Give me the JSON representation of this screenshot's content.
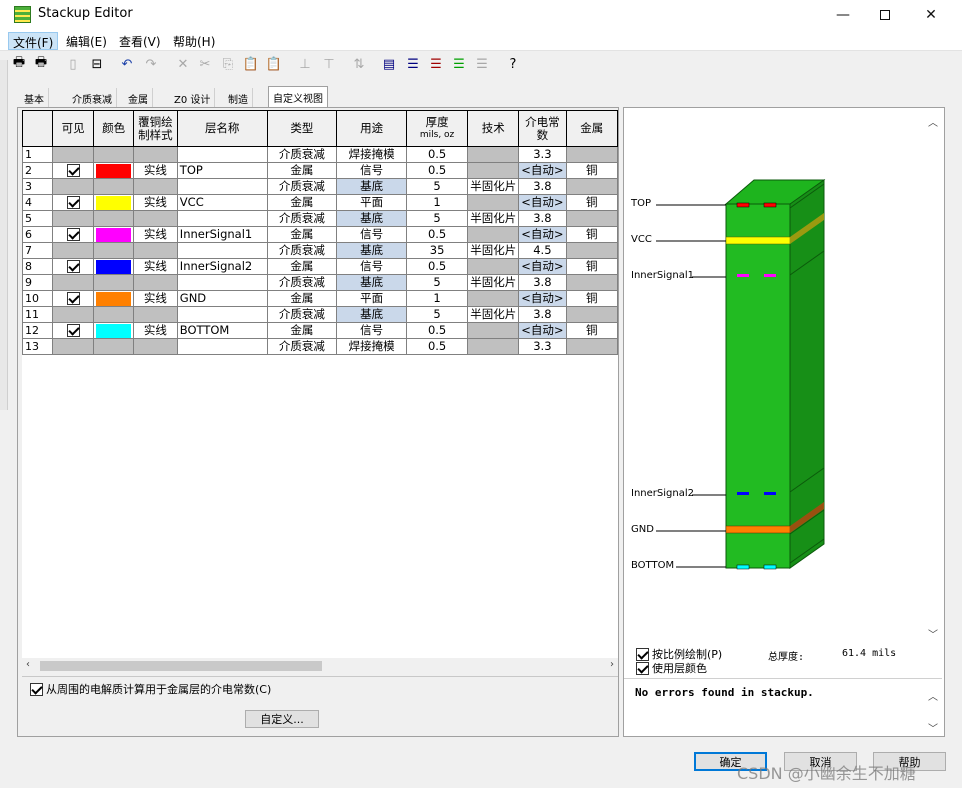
{
  "window": {
    "title": "Stackup Editor"
  },
  "menu": {
    "file": "文件(F)",
    "edit": "编辑(E)",
    "view": "查看(V)",
    "help": "帮助(H)"
  },
  "tabs": [
    "基本",
    "介质衰减",
    "金属",
    "Z0 设计",
    "制造",
    "自定义视图"
  ],
  "columns": {
    "index": "",
    "visible": "可见",
    "color": "颜色",
    "style": "覆铜绘制样式",
    "name": "层名称",
    "type": "类型",
    "usage": "用途",
    "thickness": "厚度",
    "thickness_unit": "mils, oz",
    "tech": "技术",
    "dk": "介电常数",
    "metal": "金属"
  },
  "rows": [
    {
      "n": "1",
      "visible": false,
      "color": "",
      "style": "",
      "name": "",
      "type": "介质衰减",
      "usage": "焊接掩模",
      "thickness": "0.5",
      "tech": "",
      "dk": "3.3",
      "metal": ""
    },
    {
      "n": "2",
      "visible": true,
      "color": "#ff0000",
      "style": "实线",
      "name": "TOP",
      "type": "金属",
      "usage": "信号",
      "thickness": "0.5",
      "tech": "",
      "dk": "<自动>",
      "metal": "铜"
    },
    {
      "n": "3",
      "visible": false,
      "color": "",
      "style": "",
      "name": "",
      "type": "介质衰减",
      "usage": "基底",
      "thickness": "5",
      "tech": "半固化片",
      "dk": "3.8",
      "metal": ""
    },
    {
      "n": "4",
      "visible": true,
      "color": "#ffff00",
      "style": "实线",
      "name": "VCC",
      "type": "金属",
      "usage": "平面",
      "thickness": "1",
      "tech": "",
      "dk": "<自动>",
      "metal": "铜"
    },
    {
      "n": "5",
      "visible": false,
      "color": "",
      "style": "",
      "name": "",
      "type": "介质衰减",
      "usage": "基底",
      "thickness": "5",
      "tech": "半固化片",
      "dk": "3.8",
      "metal": ""
    },
    {
      "n": "6",
      "visible": true,
      "color": "#ff00ff",
      "style": "实线",
      "name": "InnerSignal1",
      "type": "金属",
      "usage": "信号",
      "thickness": "0.5",
      "tech": "",
      "dk": "<自动>",
      "metal": "铜"
    },
    {
      "n": "7",
      "visible": false,
      "color": "",
      "style": "",
      "name": "",
      "type": "介质衰减",
      "usage": "基底",
      "thickness": "35",
      "tech": "半固化片",
      "dk": "4.5",
      "metal": ""
    },
    {
      "n": "8",
      "visible": true,
      "color": "#0000ff",
      "style": "实线",
      "name": "InnerSignal2",
      "type": "金属",
      "usage": "信号",
      "thickness": "0.5",
      "tech": "",
      "dk": "<自动>",
      "metal": "铜"
    },
    {
      "n": "9",
      "visible": false,
      "color": "",
      "style": "",
      "name": "",
      "type": "介质衰减",
      "usage": "基底",
      "thickness": "5",
      "tech": "半固化片",
      "dk": "3.8",
      "metal": ""
    },
    {
      "n": "10",
      "visible": true,
      "color": "#ff8000",
      "style": "实线",
      "name": "GND",
      "type": "金属",
      "usage": "平面",
      "thickness": "1",
      "tech": "",
      "dk": "<自动>",
      "metal": "铜"
    },
    {
      "n": "11",
      "visible": false,
      "color": "",
      "style": "",
      "name": "",
      "type": "介质衰减",
      "usage": "基底",
      "thickness": "5",
      "tech": "半固化片",
      "dk": "3.8",
      "metal": ""
    },
    {
      "n": "12",
      "visible": true,
      "color": "#00ffff",
      "style": "实线",
      "name": "BOTTOM",
      "type": "金属",
      "usage": "信号",
      "thickness": "0.5",
      "tech": "",
      "dk": "<自动>",
      "metal": "铜"
    },
    {
      "n": "13",
      "visible": false,
      "color": "",
      "style": "",
      "name": "",
      "type": "介质衰减",
      "usage": "焊接掩模",
      "thickness": "0.5",
      "tech": "",
      "dk": "3.3",
      "metal": ""
    }
  ],
  "options": {
    "compute_dk": "从周围的电解质计算用于金属层的介电常数(C)",
    "scale_draw": "按比例绘制(P)",
    "use_colors": "使用层颜色",
    "total_label": "总厚度:",
    "total_value": "61.4 mils"
  },
  "buttons": {
    "customize": "自定义...",
    "ok": "确定",
    "cancel": "取消",
    "help": "帮助"
  },
  "preview_labels": [
    "TOP",
    "VCC",
    "InnerSignal1",
    "InnerSignal2",
    "GND",
    "BOTTOM"
  ],
  "status_message": "No errors found in stackup.",
  "watermark": "CSDN @小幽余生不加糖",
  "colors": {
    "board_green": "#1db31d",
    "board_green_dark": "#157a15",
    "selection": "#cce4f7"
  }
}
